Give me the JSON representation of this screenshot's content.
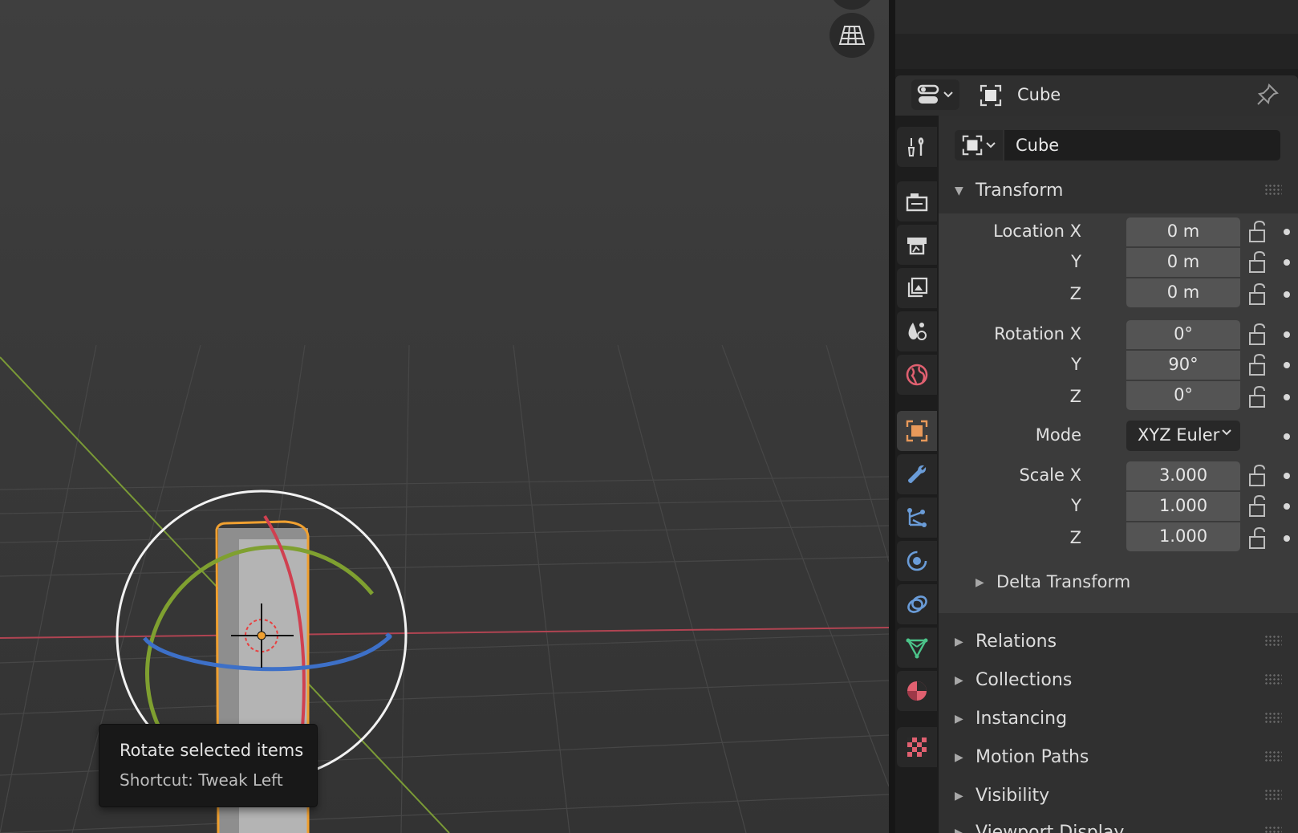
{
  "viewport": {
    "tooltip": {
      "title": "Rotate selected items",
      "shortcut": "Shortcut: Tweak Left"
    },
    "icons": [
      "navigation-gizmo-icon",
      "grid-view-icon"
    ],
    "colors": {
      "selection_outline": "#f0a030",
      "x_axis": "#d04050",
      "y_axis": "#7fa030",
      "z_axis": "#3d70c8"
    }
  },
  "properties": {
    "header": {
      "title": "Cube",
      "icons": [
        "editor-type-icon",
        "object-icon",
        "pin-icon"
      ]
    },
    "tabs": [
      {
        "id": "tool",
        "icon": "tool-icon"
      },
      {
        "id": "render",
        "icon": "render-icon"
      },
      {
        "id": "output",
        "icon": "output-icon"
      },
      {
        "id": "view-layer",
        "icon": "view-layer-icon"
      },
      {
        "id": "scene",
        "icon": "scene-icon"
      },
      {
        "id": "world",
        "icon": "world-icon"
      },
      {
        "id": "object",
        "icon": "object-icon",
        "active": true
      },
      {
        "id": "modifiers",
        "icon": "wrench-icon"
      },
      {
        "id": "particles",
        "icon": "particles-icon"
      },
      {
        "id": "physics",
        "icon": "physics-icon"
      },
      {
        "id": "constraints",
        "icon": "constraint-icon"
      },
      {
        "id": "data",
        "icon": "mesh-data-icon"
      },
      {
        "id": "material",
        "icon": "material-icon"
      },
      {
        "id": "texture",
        "icon": "texture-icon"
      }
    ],
    "object_name": "Cube",
    "transform": {
      "label": "Transform",
      "location": {
        "label": "Location X",
        "y_label": "Y",
        "z_label": "Z",
        "x": "0 m",
        "y": "0 m",
        "z": "0 m"
      },
      "rotation": {
        "label": "Rotation X",
        "y_label": "Y",
        "z_label": "Z",
        "x": "0°",
        "y": "90°",
        "z": "0°"
      },
      "mode": {
        "label": "Mode",
        "value": "XYZ Euler"
      },
      "scale": {
        "label": "Scale X",
        "y_label": "Y",
        "z_label": "Z",
        "x": "3.000",
        "y": "1.000",
        "z": "1.000"
      },
      "delta": "Delta Transform"
    },
    "panels": [
      "Relations",
      "Collections",
      "Instancing",
      "Motion Paths",
      "Visibility",
      "Viewport Display"
    ],
    "accent": "#e8995a"
  }
}
